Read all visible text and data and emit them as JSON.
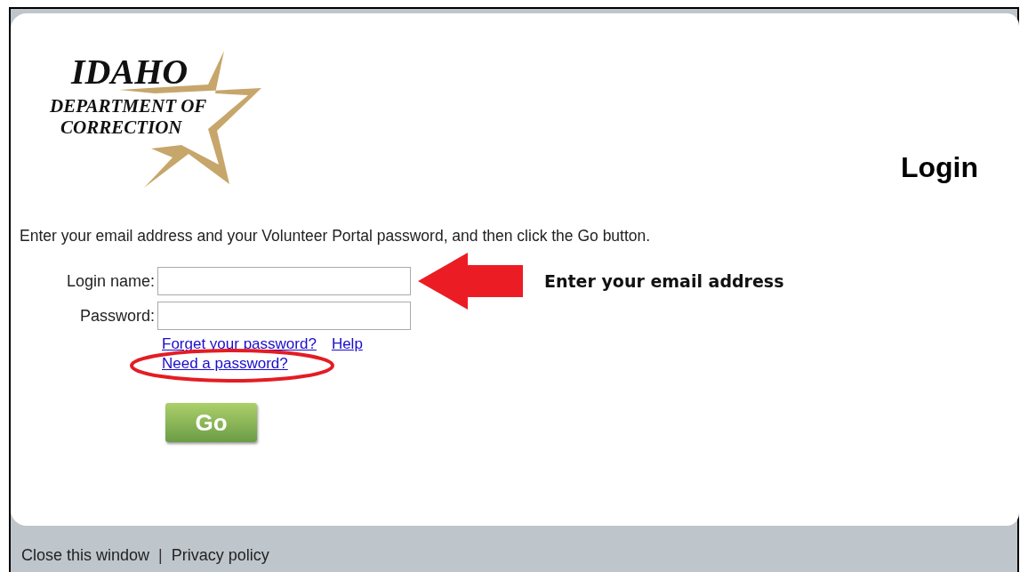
{
  "logo": {
    "line_1": "IDAHO",
    "line_2": "DEPARTMENT OF",
    "line_3": "CORRECTION"
  },
  "title": "Login",
  "instruction": "Enter your email address and your Volunteer Portal password, and then click the Go button.",
  "fields": [
    {
      "label": "Login name:"
    },
    {
      "label": "Password:"
    }
  ],
  "links": [
    {
      "label": "Forget your password?"
    },
    {
      "label": "Help"
    },
    {
      "label": "Need a password?"
    }
  ],
  "annotation": "Enter your email address",
  "go_button": "Go",
  "footer": {
    "links": [
      "Close this window",
      "Privacy policy"
    ],
    "separator": "|"
  }
}
